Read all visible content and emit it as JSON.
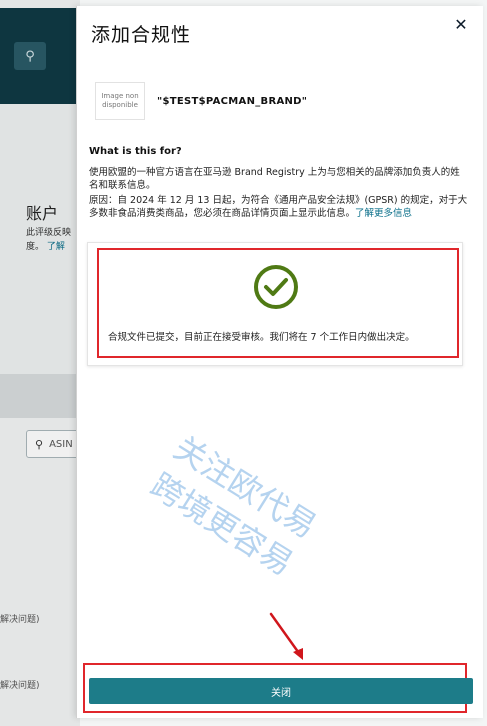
{
  "background": {
    "account_title": "账户",
    "description_fragment": "此评级反映",
    "description_fragment_2": "度。",
    "learn_link": "了解",
    "search_placeholder": "ASIN",
    "row_label_1": "解决问题)",
    "row_label_2": "解决问题)"
  },
  "modal": {
    "title": "添加合规性",
    "brand": {
      "image_placeholder": "Image non disponible",
      "name": "\"$TEST$PACMAN_BRAND\""
    },
    "info": {
      "heading": "What is this for?",
      "line1": "使用欧盟的一种官方语言在亚马逊 Brand Registry 上为与您相关的品牌添加负责人的姓名和联系信息。",
      "line2": "原因：自 2024 年 12 月 13 日起，为符合《通用产品安全法规》(GPSR) 的规定，对于大多数非食品消费类商品，您必须在商品详情页面上显示此信息。",
      "learn_more": "了解更多信息"
    },
    "status_message": "合规文件已提交，目前正在接受审核。我们将在 7 个工作日内做出决定。",
    "close_button": "关闭"
  },
  "watermark": {
    "line1": "关注欧代易",
    "line2": "跨境更容易"
  },
  "colors": {
    "accent": "#1d7c89",
    "check": "#4f7a14",
    "highlight": "#e0262b"
  }
}
